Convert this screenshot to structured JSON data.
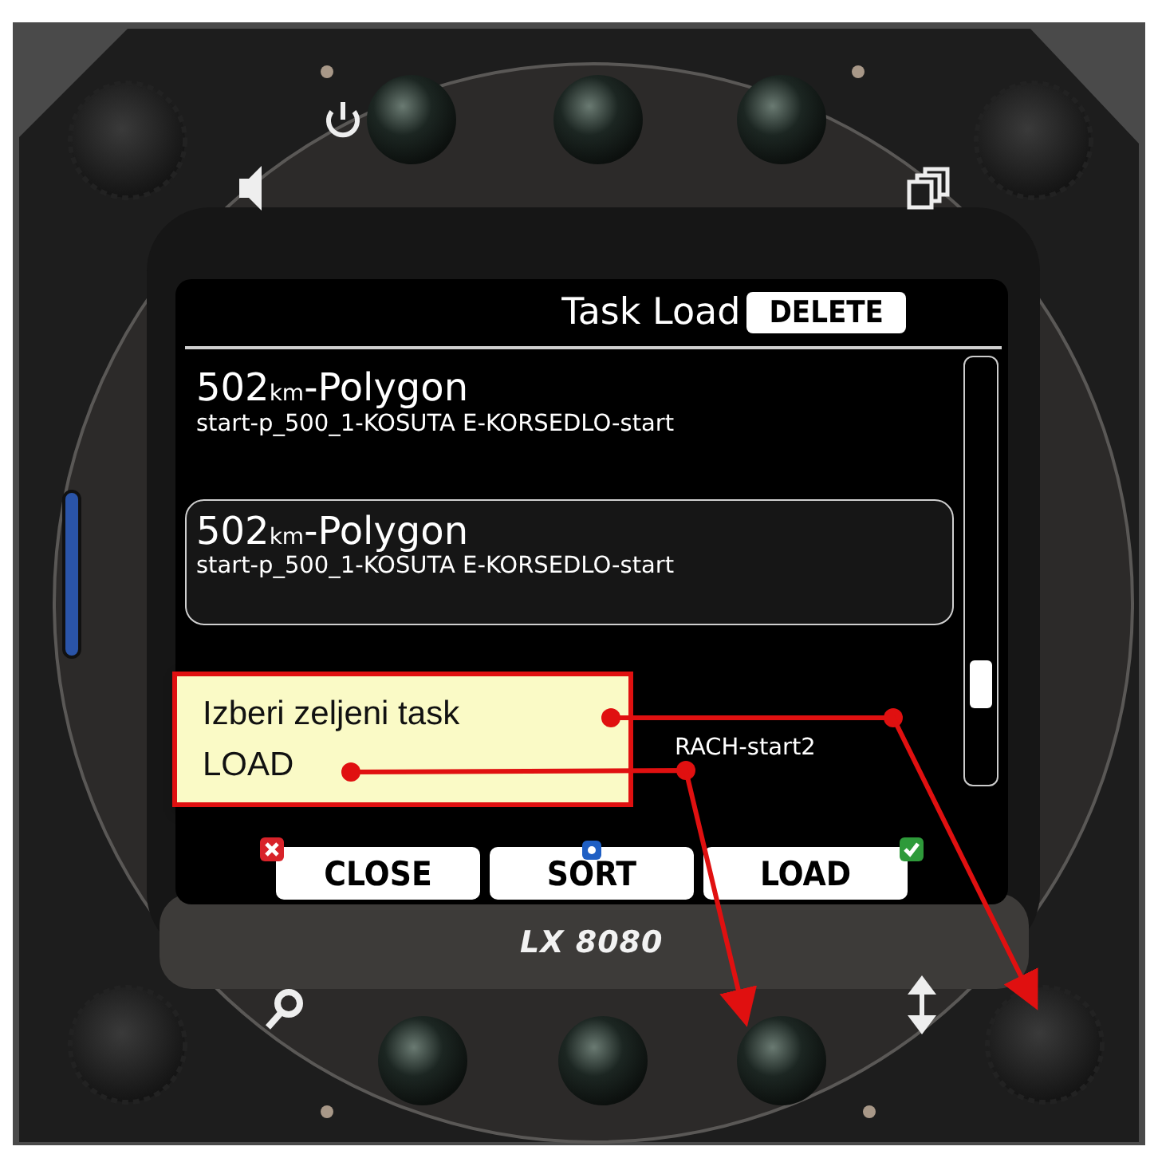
{
  "device": {
    "model": "LX 8080"
  },
  "screen": {
    "title": "Task Load",
    "header_button": "DELETE",
    "tasks": [
      {
        "name": "502$_{km}$-Polygon",
        "route": "start-p_500_1-KOSUTA E-KORSEDLO-start",
        "selected": false,
        "covered": false
      },
      {
        "name": "502$_{km}$-Polygon",
        "route": "start-p_500_1-KOSUTA E-KORSEDLO-start",
        "selected": true,
        "covered": false
      },
      {
        "route": "RACH-start2",
        "selected": false,
        "covered": true
      }
    ],
    "buttons": [
      {
        "label": "CLOSE",
        "kind": "close"
      },
      {
        "label": "SORT",
        "kind": "sort"
      },
      {
        "label": "LOAD",
        "kind": "ok"
      }
    ]
  },
  "callout": {
    "lines": [
      "Izberi zeljeni task",
      "LOAD"
    ]
  }
}
